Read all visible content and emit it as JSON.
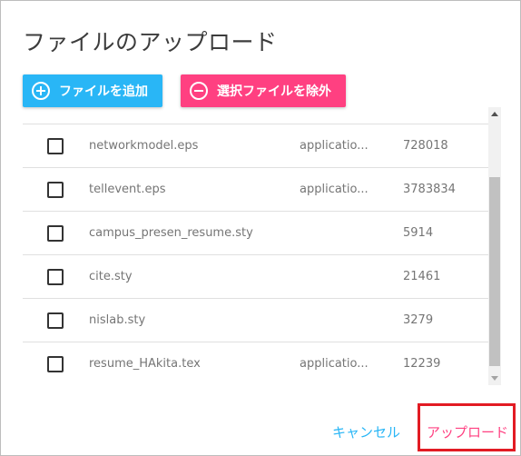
{
  "dialog": {
    "title": "ファイルのアップロード"
  },
  "toolbar": {
    "add_label": "ファイルを追加",
    "remove_label": "選択ファイルを除外"
  },
  "files": [
    {
      "name": "networkmodel.eps",
      "type": "applicatio...",
      "size": "728018",
      "checked": false
    },
    {
      "name": "tellevent.eps",
      "type": "applicatio...",
      "size": "3783834",
      "checked": false
    },
    {
      "name": "campus_presen_resume.sty",
      "type": "",
      "size": "5914",
      "checked": false
    },
    {
      "name": "cite.sty",
      "type": "",
      "size": "21461",
      "checked": false
    },
    {
      "name": "nislab.sty",
      "type": "",
      "size": "3279",
      "checked": false
    },
    {
      "name": "resume_HAkita.tex",
      "type": "applicatio...",
      "size": "12239",
      "checked": false
    }
  ],
  "actions": {
    "cancel_label": "キャンセル",
    "upload_label": "アップロード"
  },
  "colors": {
    "accent_blue": "#29b6f6",
    "accent_pink": "#ff4081",
    "highlight_red": "#e21b23"
  }
}
